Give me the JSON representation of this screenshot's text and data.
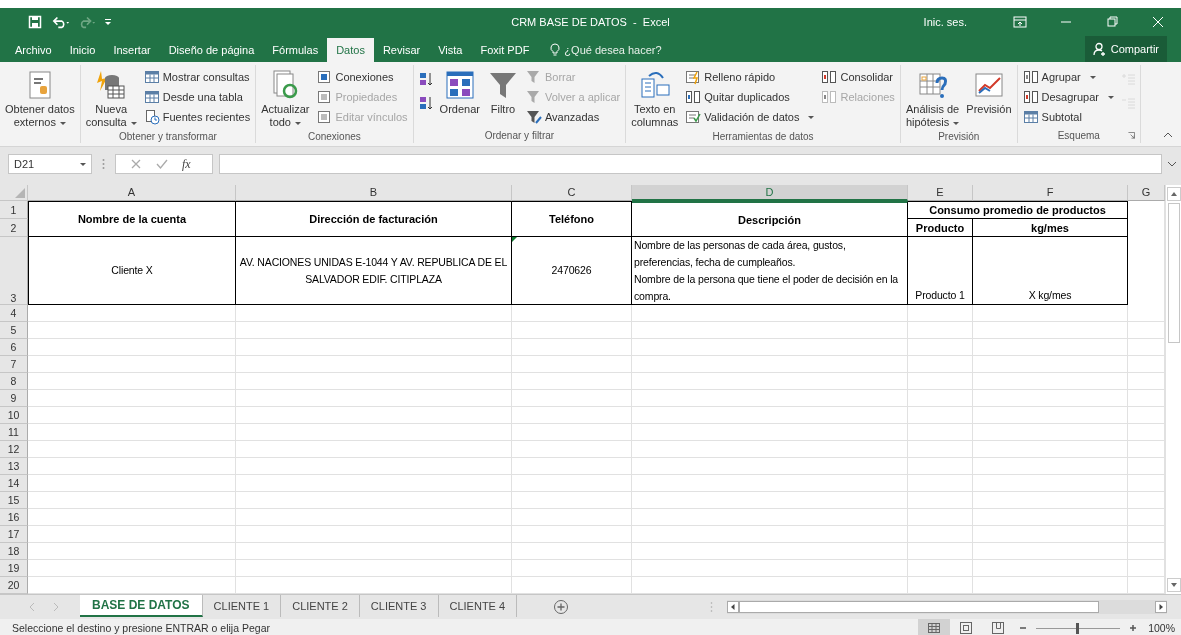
{
  "title_bar": {
    "title": "CRM BASE DE DATOS  -  Excel",
    "sign_in": "Inic. ses."
  },
  "menu_tabs": [
    {
      "label": "Archivo",
      "selected": false
    },
    {
      "label": "Inicio",
      "selected": false
    },
    {
      "label": "Insertar",
      "selected": false
    },
    {
      "label": "Diseño de página",
      "selected": false
    },
    {
      "label": "Fórmulas",
      "selected": false
    },
    {
      "label": "Datos",
      "selected": true
    },
    {
      "label": "Revisar",
      "selected": false
    },
    {
      "label": "Vista",
      "selected": false
    },
    {
      "label": "Foxit PDF",
      "selected": false
    }
  ],
  "tell_me": {
    "placeholder": "¿Qué desea hacer?"
  },
  "share_button": "Compartir",
  "ribbon_groups": [
    {
      "columns": [
        [
          {
            "kind": "large",
            "label": "Obtener datos\nexternos",
            "dropdown": true,
            "disabled": false
          }
        ]
      ]
    },
    {
      "label": "Obtener y transformar",
      "columns": [
        [
          {
            "kind": "large",
            "label": "Nueva\nconsulta",
            "dropdown": true,
            "disabled": false
          }
        ],
        [
          {
            "kind": "small",
            "label": "Mostrar consultas",
            "dropdown": false,
            "disabled": false
          },
          {
            "kind": "small",
            "label": "Desde una tabla",
            "dropdown": false,
            "disabled": false
          },
          {
            "kind": "small",
            "label": "Fuentes recientes",
            "dropdown": false,
            "disabled": false
          }
        ]
      ]
    },
    {
      "label": "Conexiones",
      "columns": [
        [
          {
            "kind": "large",
            "label": "Actualizar\ntodo",
            "dropdown": true,
            "disabled": false
          }
        ],
        [
          {
            "kind": "small",
            "label": "Conexiones",
            "dropdown": false,
            "disabled": false
          },
          {
            "kind": "small",
            "label": "Propiedades",
            "dropdown": false,
            "disabled": true
          },
          {
            "kind": "small",
            "label": "Editar vínculos",
            "dropdown": false,
            "disabled": true
          }
        ]
      ]
    },
    {
      "label": "Ordenar y filtrar",
      "columns": [
        [
          {
            "kind": "icon",
            "disabled": false
          },
          {
            "kind": "icon",
            "disabled": false
          }
        ],
        [
          {
            "kind": "large",
            "label": "Ordenar",
            "dropdown": false,
            "disabled": false
          }
        ],
        [
          {
            "kind": "large",
            "label": "Filtro",
            "dropdown": false,
            "disabled": false
          }
        ],
        [
          {
            "kind": "small",
            "label": "Borrar",
            "dropdown": false,
            "disabled": true
          },
          {
            "kind": "small",
            "label": "Volver a aplicar",
            "dropdown": false,
            "disabled": true
          },
          {
            "kind": "small",
            "label": "Avanzadas",
            "dropdown": false,
            "disabled": false
          }
        ]
      ]
    },
    {
      "label": "Herramientas de datos",
      "columns": [
        [
          {
            "kind": "large",
            "label": "Texto en\ncolumnas",
            "dropdown": false,
            "disabled": false
          }
        ],
        [
          {
            "kind": "small",
            "label": "Relleno rápido",
            "dropdown": false,
            "disabled": false
          },
          {
            "kind": "small",
            "label": "Quitar duplicados",
            "dropdown": false,
            "disabled": false
          },
          {
            "kind": "small",
            "label": "Validación de datos",
            "dropdown": true,
            "disabled": false
          }
        ],
        [
          {
            "kind": "small",
            "label": "Consolidar",
            "dropdown": false,
            "disabled": false
          },
          {
            "kind": "small",
            "label": "Relaciones",
            "dropdown": false,
            "disabled": true
          }
        ]
      ]
    },
    {
      "label": "Previsión",
      "columns": [
        [
          {
            "kind": "large",
            "label": "Análisis de\nhipótesis",
            "dropdown": true,
            "disabled": false
          }
        ],
        [
          {
            "kind": "large",
            "label": "Previsión",
            "dropdown": false,
            "disabled": false
          }
        ]
      ]
    },
    {
      "label": "Esquema",
      "columns": [
        [
          {
            "kind": "small",
            "label": "Agrupar",
            "dropdown": true,
            "disabled": false
          },
          {
            "kind": "small",
            "label": "Desagrupar",
            "dropdown": true,
            "disabled": false
          },
          {
            "kind": "small",
            "label": "Subtotal",
            "dropdown": false,
            "disabled": false
          }
        ],
        [
          {
            "kind": "icon",
            "disabled": true
          },
          {
            "kind": "icon",
            "disabled": true
          }
        ]
      ]
    }
  ],
  "formula_bar": {
    "name_box": "D21",
    "function_button": "fx"
  },
  "sheet": {
    "columns": [
      {
        "label": "A",
        "selected": false
      },
      {
        "label": "B",
        "selected": false
      },
      {
        "label": "C",
        "selected": false
      },
      {
        "label": "D",
        "selected": true
      },
      {
        "label": "E",
        "selected": false
      },
      {
        "label": "F",
        "selected": false
      },
      {
        "label": "G",
        "selected": false
      }
    ],
    "row_numbers": [
      "1",
      "2",
      "3",
      "4",
      "5",
      "6",
      "7",
      "8",
      "9",
      "10",
      "11",
      "12",
      "13",
      "14",
      "15",
      "16",
      "17",
      "18",
      "19",
      "20"
    ],
    "header": [
      "Nombre de la cuenta",
      "Dirección de facturación",
      "Teléfono",
      "Descripción"
    ],
    "group_header": {
      "label": "Consumo promedio de productos",
      "columns": [
        "Producto",
        "kg/mes"
      ]
    },
    "rows": [
      [
        "Cliente X",
        "AV. NACIONES UNIDAS E-1044 Y AV. REPUBLICA DE EL SALVADOR EDIF. CITIPLAZA",
        "2470626",
        "Nombre de las personas de cada área, gustos, preferencias, fecha de cumpleaños.\nNombre de la persona que tiene el poder de decisión en la compra.",
        "Producto 1",
        "X kg/mes"
      ]
    ]
  },
  "sheet_tabs": [
    {
      "label": "BASE DE DATOS",
      "selected": true
    },
    {
      "label": "CLIENTE 1",
      "selected": false
    },
    {
      "label": "CLIENTE 2",
      "selected": false
    },
    {
      "label": "CLIENTE 3",
      "selected": false
    },
    {
      "label": "CLIENTE 4",
      "selected": false
    }
  ],
  "status_bar": {
    "text": "Seleccione el destino y presione ENTRAR o elija Pegar",
    "view_buttons": [
      {
        "selected": true
      },
      {
        "selected": false
      },
      {
        "selected": false
      }
    ],
    "zoom": {
      "level": 0.5,
      "reading": "100%"
    }
  }
}
